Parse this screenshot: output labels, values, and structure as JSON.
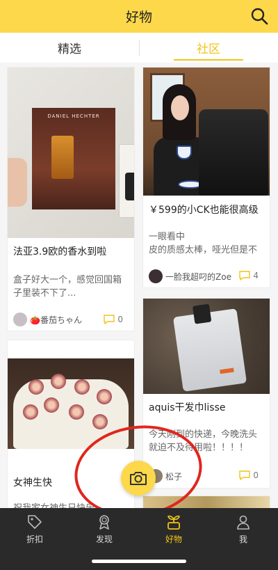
{
  "header": {
    "title": "好物",
    "search_icon": "search-icon"
  },
  "tabs": [
    {
      "label": "精选",
      "active": false
    },
    {
      "label": "社区",
      "active": true
    }
  ],
  "cards": {
    "left1": {
      "title": "法亚3.9欧的香水到啦",
      "desc": "盒子好大一个，感觉回国箱子里装不下了...",
      "author": "🍅番茄ちゃん",
      "comments": "0",
      "poster_label": "DANIEL HECHTER"
    },
    "right1": {
      "title": "￥599的小CK也能很高级",
      "desc": "一眼看中\n皮的质感太棒，哑光但是不",
      "author": "一脸我超叼的Zoe",
      "comments": "4"
    },
    "right2": {
      "title": "aquis干发巾lisse",
      "desc": "今天刚到的快递，今晚洗头就迫不及待用啦！！！！",
      "author": "松子",
      "comments": "0"
    },
    "left2": {
      "title": "女神生快",
      "desc": "祝我家女神生日快乐"
    }
  },
  "fab": {
    "icon": "camera-icon"
  },
  "bottom_nav": [
    {
      "label": "折扣",
      "icon": "tag-icon",
      "active": false
    },
    {
      "label": "发现",
      "icon": "medal-icon",
      "active": false
    },
    {
      "label": "好物",
      "icon": "sprout-icon",
      "active": true
    },
    {
      "label": "我",
      "icon": "user-icon",
      "active": false
    }
  ],
  "colors": {
    "accent": "#fcd84a",
    "active_text": "#f0c419",
    "nav_bg": "#2b2a2a",
    "annotation": "#e0261e"
  }
}
